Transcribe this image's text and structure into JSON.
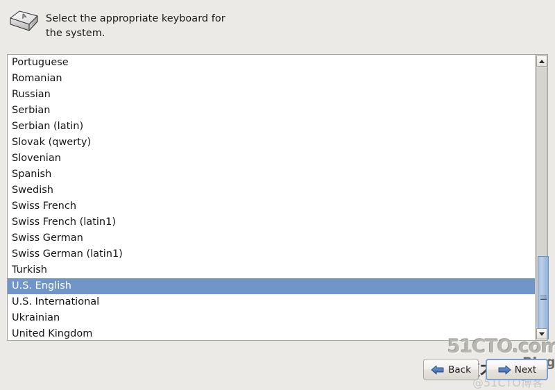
{
  "header": {
    "icon": "keyboard-key-icon",
    "icon_letter": "A",
    "instruction": "Select the appropriate keyboard for\nthe system."
  },
  "keyboard_list": {
    "selected": "U.S. English",
    "selection_color": "#7096c8",
    "items": [
      "Portuguese",
      "Romanian",
      "Russian",
      "Serbian",
      "Serbian (latin)",
      "Slovak (qwerty)",
      "Slovenian",
      "Spanish",
      "Swedish",
      "Swiss French",
      "Swiss French (latin1)",
      "Swiss German",
      "Swiss German (latin1)",
      "Turkish",
      "U.S. English",
      "U.S. International",
      "Ukrainian",
      "United Kingdom"
    ]
  },
  "scrollbar": {
    "up_icon": "scroll-up-arrow-icon",
    "down_icon": "scroll-down-arrow-icon",
    "thumb_color": "#a8bfe0"
  },
  "buttons": {
    "back": {
      "label": "Back",
      "icon": "arrow-left-icon"
    },
    "next": {
      "label": "Next",
      "icon": "arrow-right-icon"
    }
  },
  "watermark": {
    "site": "51CTO.com",
    "chinese": "技术博客",
    "blog": "Blog",
    "handle": "@51CTO博客"
  },
  "colors": {
    "background": "#eceae7",
    "list_background": "#ffffff",
    "accent": "#7096c8"
  }
}
